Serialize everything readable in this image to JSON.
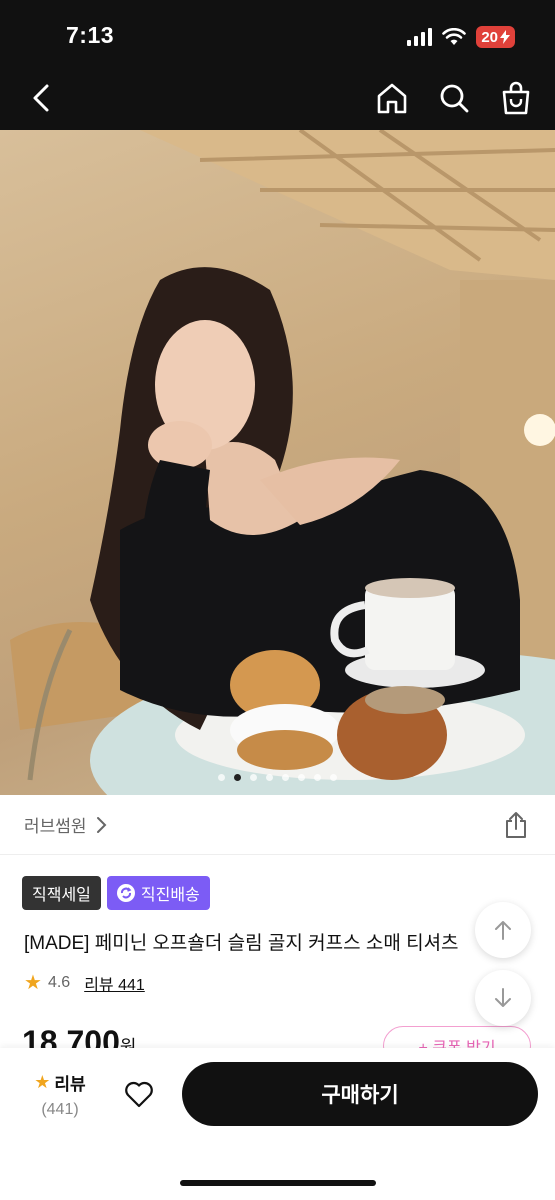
{
  "status_bar": {
    "time": "7:13",
    "battery": "20"
  },
  "hero": {
    "dots_total": 8,
    "active_index": 1
  },
  "brand": {
    "name": "러브썸원"
  },
  "badges": [
    {
      "label": "직잭세일"
    },
    {
      "label": "직진배송"
    }
  ],
  "product": {
    "title": "[MADE] 페미닌 오프숄더 슬림 골지 커프스 소매 티셔츠",
    "rating": "4.6",
    "reviews_label": "리뷰 441",
    "price": "18,700",
    "price_unit": "원",
    "coupon_label": "+ 쿠폰 받기"
  },
  "bottom": {
    "review_label": "리뷰",
    "review_count": "(441)",
    "buy_label": "구매하기"
  },
  "colors": {
    "accent_purple": "#7c5cf5",
    "star": "#f0a51e",
    "coupon_pink": "#e766b6"
  }
}
